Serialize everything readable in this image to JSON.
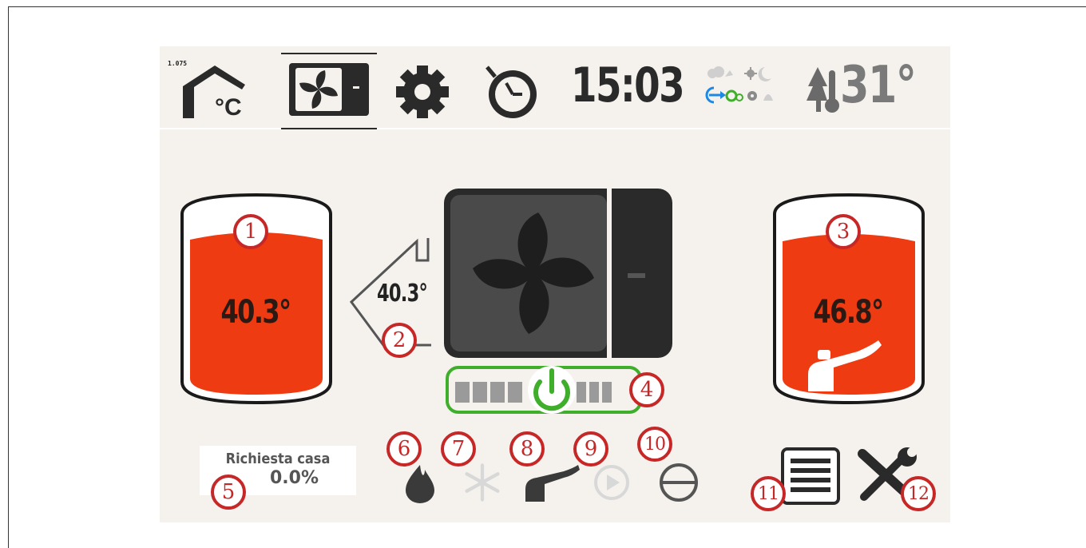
{
  "header": {
    "zone_id": "1.075",
    "time": "15:03",
    "outdoor_temp": "31°",
    "colors": {
      "icon": "#2a2a2a",
      "accent_green": "#3fae2a",
      "accent_blue": "#1e88e5",
      "muted": "#9a9a9a"
    }
  },
  "nav": [
    {
      "name": "room-temperature",
      "icon": "house-celsius-icon",
      "glyph": "°C"
    },
    {
      "name": "heat-pump",
      "icon": "heat-pump-fan-icon",
      "selected": true
    },
    {
      "name": "settings",
      "icon": "gear-icon"
    },
    {
      "name": "timer",
      "icon": "timer-icon"
    }
  ],
  "status_icons": [
    "cloudy-icon",
    "sun-icon",
    "moon-icon",
    "source-arrow-icon",
    "gear-green-icon",
    "outdoor-thermometer-icon"
  ],
  "left_tank": {
    "temp": "40.3°",
    "callout": "1",
    "fill_color": "#ee3b12"
  },
  "flow": {
    "temp": "40.3°",
    "callout": "2"
  },
  "right_tank": {
    "temp": "46.8°",
    "callout": "3",
    "fill_color": "#ee3b12",
    "icon": "faucet-icon"
  },
  "power_bar": {
    "callout": "4",
    "color": "#3fae2a",
    "icon": "power-icon"
  },
  "demand": {
    "label": "Richiesta casa",
    "value": "0.0%",
    "callout": "5"
  },
  "modes": [
    {
      "callout": "6",
      "icon": "flame-icon",
      "active": true
    },
    {
      "callout": "7",
      "icon": "snowflake-icon",
      "active": false
    },
    {
      "callout": "8",
      "icon": "faucet-icon",
      "active": true
    },
    {
      "callout": "9",
      "icon": "play-circle-icon",
      "active": false
    },
    {
      "callout": "10",
      "icon": "compressor-icon",
      "active": true
    }
  ],
  "actions": [
    {
      "callout": "11",
      "icon": "list-icon"
    },
    {
      "callout": "12",
      "icon": "tools-icon"
    }
  ]
}
